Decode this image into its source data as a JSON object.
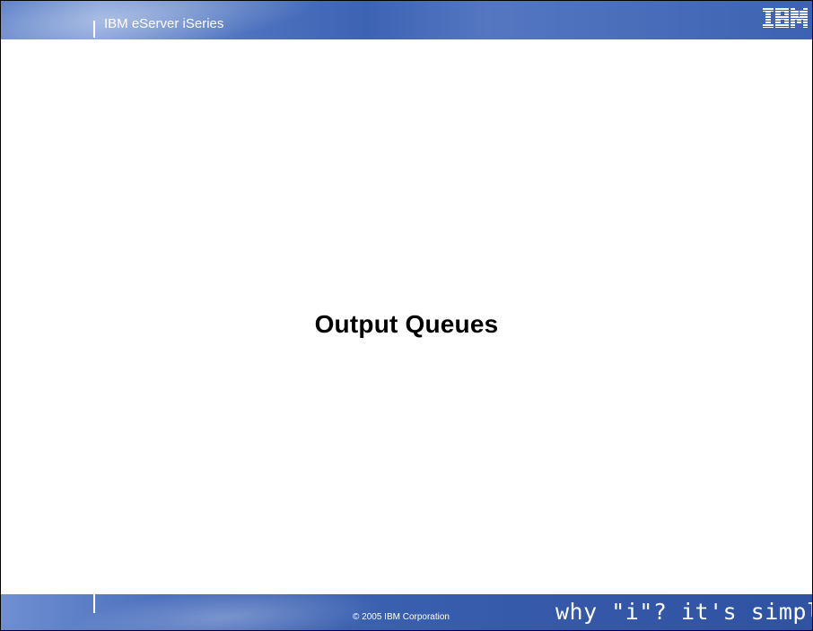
{
  "header": {
    "title": "IBM eServer iSeries",
    "logo_text": "IBM"
  },
  "main": {
    "title": "Output Queues"
  },
  "footer": {
    "copyright": "© 2005 IBM Corporation",
    "tagline": "why \"i\"?  it's simple."
  },
  "colors": {
    "header_blue": "#4e73bf",
    "footer_blue": "#3558a8",
    "text_white": "#ffffff"
  }
}
